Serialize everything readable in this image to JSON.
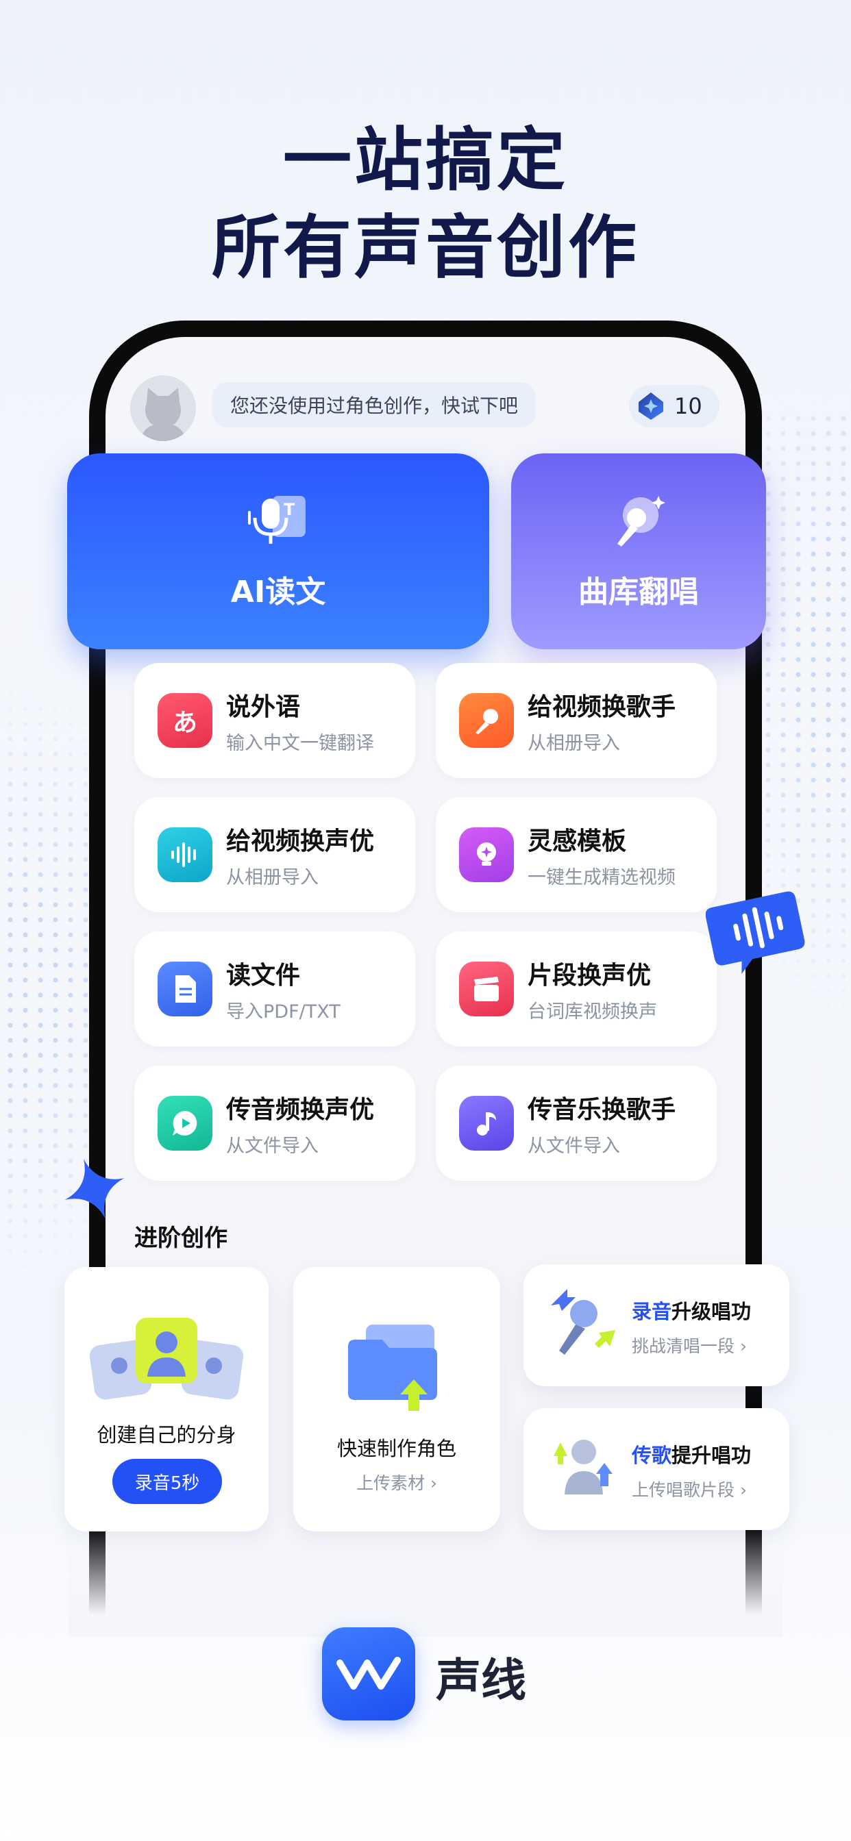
{
  "headline": {
    "line1": "一站搞定",
    "line2": "所有声音创作"
  },
  "header": {
    "prompt": "您还没使用过角色创作，快试下吧",
    "credits": "10"
  },
  "primary_cards": [
    {
      "label": "AI读文",
      "icon": "microphone-text-icon"
    },
    {
      "label": "曲库翻唱",
      "icon": "karaoke-mic-icon"
    }
  ],
  "features": [
    {
      "title": "说外语",
      "subtitle": "输入中文一键翻译",
      "icon": "hiragana-icon",
      "color": "#f0455a"
    },
    {
      "title": "给视频换歌手",
      "subtitle": "从相册导入",
      "icon": "microphone-icon",
      "color": "#ff6a33"
    },
    {
      "title": "给视频换声优",
      "subtitle": "从相册导入",
      "icon": "soundwave-icon",
      "color": "#13b8d6"
    },
    {
      "title": "灵感模板",
      "subtitle": "一键生成精选视频",
      "icon": "lightbulb-icon",
      "color": "#c04ff0"
    },
    {
      "title": "读文件",
      "subtitle": "导入PDF/TXT",
      "icon": "document-icon",
      "color": "#3c6ff5"
    },
    {
      "title": "片段换声优",
      "subtitle": "台词库视频换声",
      "icon": "clapperboard-icon",
      "color": "#f0405e"
    },
    {
      "title": "传音频换声优",
      "subtitle": "从文件导入",
      "icon": "play-bubble-icon",
      "color": "#17c6a4"
    },
    {
      "title": "传音乐换歌手",
      "subtitle": "从文件导入",
      "icon": "music-note-icon",
      "color": "#6d5bf2"
    }
  ],
  "advanced": {
    "title": "进阶创作",
    "avatar_card": {
      "label": "创建自己的分身",
      "button": "录音5秒"
    },
    "role_card": {
      "label": "快速制作角色",
      "sub": "上传素材 ›"
    },
    "record_card": {
      "title_hl": "录音",
      "title_rest": "升级唱功",
      "sub": "挑战清唱一段 ›"
    },
    "upload_card": {
      "title_hl": "传歌",
      "title_rest": "提升唱功",
      "sub": "上传唱歌片段 ›"
    }
  },
  "brand": {
    "name": "声线"
  },
  "colors": {
    "accent": "#2451f5",
    "headline": "#10194a"
  }
}
